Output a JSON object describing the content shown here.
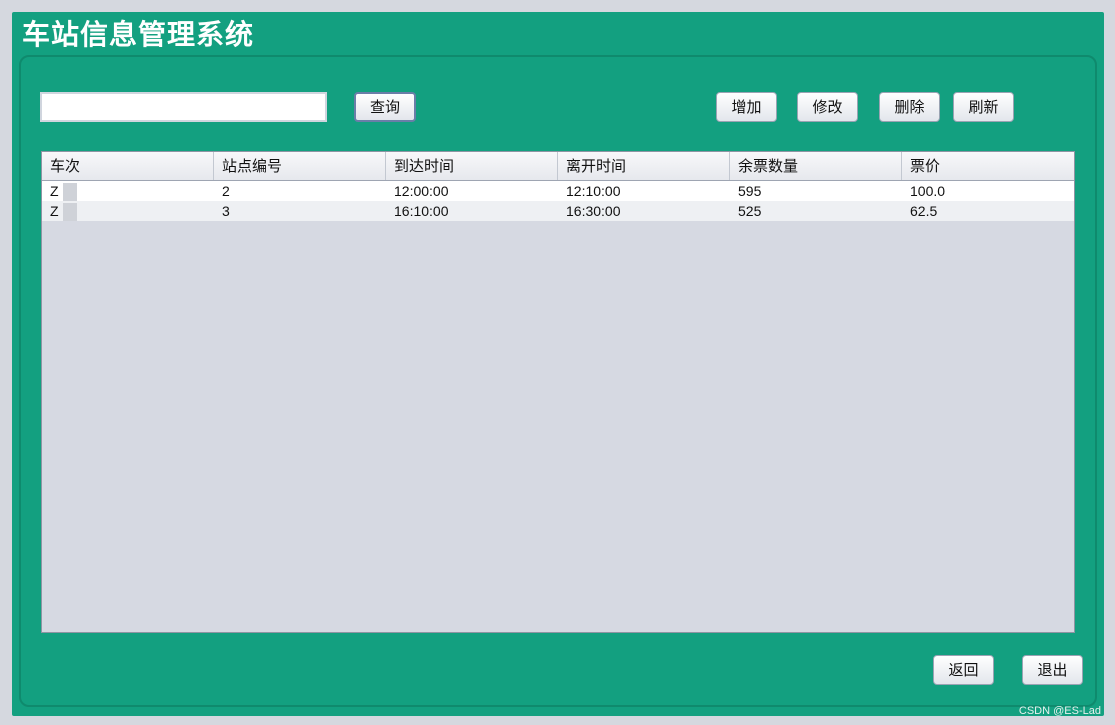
{
  "window": {
    "title": "车站信息管理系统"
  },
  "search": {
    "value": "",
    "button_label": "查询"
  },
  "toolbar": {
    "add_label": "增加",
    "edit_label": "修改",
    "delete_label": "删除",
    "refresh_label": "刷新"
  },
  "table": {
    "columns": [
      "车次",
      "站点编号",
      "到达时间",
      "离开时间",
      "余票数量",
      "票价"
    ],
    "rows": [
      [
        "Z",
        "2",
        "12:00:00",
        "12:10:00",
        "595",
        "100.0"
      ],
      [
        "Z",
        "3",
        "16:10:00",
        "16:30:00",
        "525",
        "62.5"
      ]
    ]
  },
  "footer": {
    "back_label": "返回",
    "exit_label": "退出"
  },
  "watermark": "CSDN @ES-Lad",
  "colors": {
    "frame": "#13a080",
    "background": "#d5d8df",
    "table_bg": "#d6d9e2"
  }
}
